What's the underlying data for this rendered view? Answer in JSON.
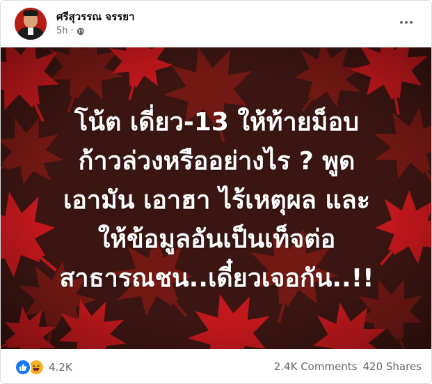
{
  "post": {
    "author": "ศรีสุวรรณ จรรยา",
    "timestamp": "5h",
    "separator": "·",
    "privacy_icon": "globe-icon",
    "menu_icon": "more-options-icon"
  },
  "image": {
    "lines": [
      "โน้ต เดี่ยว-13 ให้ท้ายม็อบ",
      "ก้าวล่วงหรืออย่างไร ? พูด",
      "เอามัน เอาฮา ไร้เหตุผล และ",
      "ให้ข้อมูลอันเป็นเท็จต่อ",
      "สาธารณชน..เดี๋ยวเจอกัน..!!"
    ],
    "background_color": "#3a1512",
    "leaf_color": "#c0181c"
  },
  "footer": {
    "reaction_icons": [
      "like-icon",
      "haha-icon"
    ],
    "reaction_count": "4.2K",
    "comments": "2.4K Comments",
    "shares": "420 Shares"
  }
}
